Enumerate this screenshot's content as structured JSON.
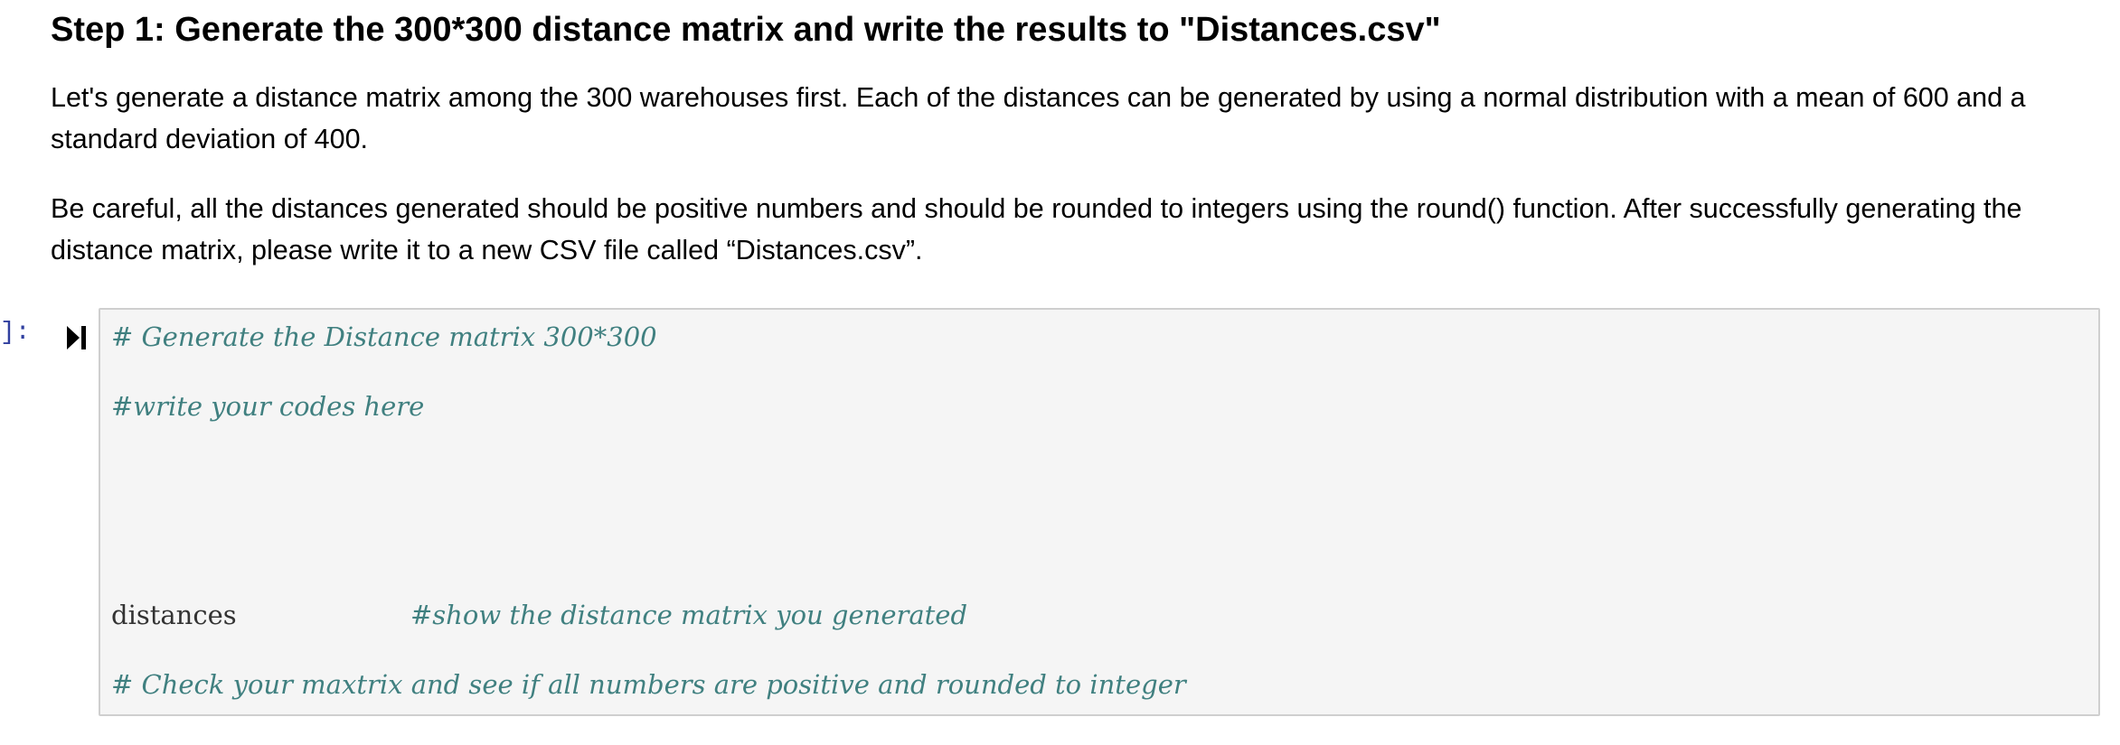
{
  "markdown": {
    "heading": "Step 1: Generate the 300*300 distance matrix and write the results to \"Distances.csv\"",
    "paragraph1": "Let's generate a distance matrix among the 300 warehouses first. Each of the distances can be generated by using a normal distribution with a mean of 600 and a standard deviation of 400.",
    "paragraph2": "Be careful, all the distances generated should be positive numbers and should be rounded to integers using the round() function. After successfully generating the distance matrix, please write it to a new CSV file called “Distances.csv”."
  },
  "code_cell": {
    "prompt": "]:",
    "run_icon": "run-cell-icon",
    "lines": {
      "line1": "# Generate the Distance matrix 300*300",
      "line2": "#write your codes here",
      "line3_code": "distances",
      "line3_comment": "#show the distance matrix you generated",
      "line4": "# Check your maxtrix and see if all numbers are positive and rounded to integer"
    }
  },
  "colors": {
    "comment": "#408080",
    "prompt": "#303f9f",
    "cell_background": "#f5f5f5",
    "cell_border": "#cfcfcf"
  }
}
